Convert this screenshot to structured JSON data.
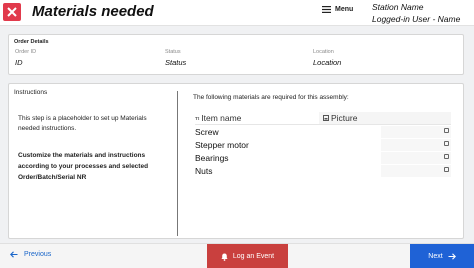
{
  "header": {
    "logo_icon": "tulip-logo-icon",
    "title": "Materials needed",
    "menu_label": "Menu",
    "station_name": "Station Name",
    "user_label": "Logged-in User - Name"
  },
  "order_details": {
    "heading": "Order Details",
    "fields": [
      {
        "label": "Order ID",
        "value": "ID"
      },
      {
        "label": "Status",
        "value": "Status"
      },
      {
        "label": "Location",
        "value": "Location"
      }
    ]
  },
  "instructions": {
    "heading": "Instructions",
    "body": "This step is a placeholder to set up Materials needed instructions.",
    "bold_text": "Customize the materials and instructions according to your processes and selected Order/Batch/Serial NR"
  },
  "materials": {
    "heading": "The following materials are required for this assembly:",
    "columns": [
      {
        "label": "Item name",
        "icon": "text-type-icon"
      },
      {
        "label": "Picture",
        "icon": "image-icon"
      }
    ],
    "rows": [
      {
        "name": "Screw"
      },
      {
        "name": "Stepper motor"
      },
      {
        "name": "Bearings"
      },
      {
        "name": "Nuts"
      }
    ]
  },
  "footer": {
    "previous_label": "Previous",
    "event_label": "Log an Event",
    "next_label": "Next"
  },
  "colors": {
    "logo": "#e13a4c",
    "event_button": "#c9403e",
    "next_button": "#1f62d6",
    "previous_text": "#1a66c9"
  }
}
